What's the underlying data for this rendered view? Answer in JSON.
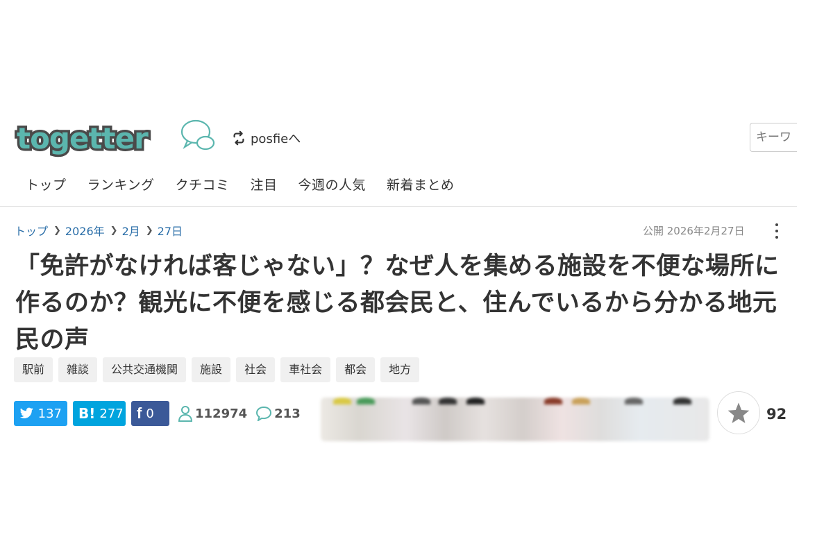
{
  "header": {
    "logo_text": "togetter",
    "posfie_label": "posfieへ",
    "search_placeholder": "キーワ"
  },
  "nav": [
    "トップ",
    "ランキング",
    "クチコミ",
    "注目",
    "今週の人気",
    "新着まとめ"
  ],
  "breadcrumb": [
    "トップ",
    "2026年",
    "2月",
    "27日"
  ],
  "published": "公開 2026年2月27日",
  "title": "「免許がなければ客じゃない」？なぜ人を集める施設を不便な場所に作るのか？観光に不便を感じる都会民と、住んでいるから分かる地元民の声",
  "tags": [
    "駅前",
    "雑談",
    "公共交通機関",
    "施設",
    "社会",
    "車社会",
    "都会",
    "地方"
  ],
  "share": {
    "twitter_count": "137",
    "hatena_label": "B!",
    "hatena_count": "277",
    "facebook_label": "f",
    "facebook_count": "0",
    "views": "112974",
    "comments": "213"
  },
  "favorites": "92",
  "colors": {
    "twitter": "#1da1f2",
    "hatena": "#00a4de",
    "facebook": "#3b5998",
    "logo": "#5bb6ae",
    "link": "#2a6ea8"
  }
}
